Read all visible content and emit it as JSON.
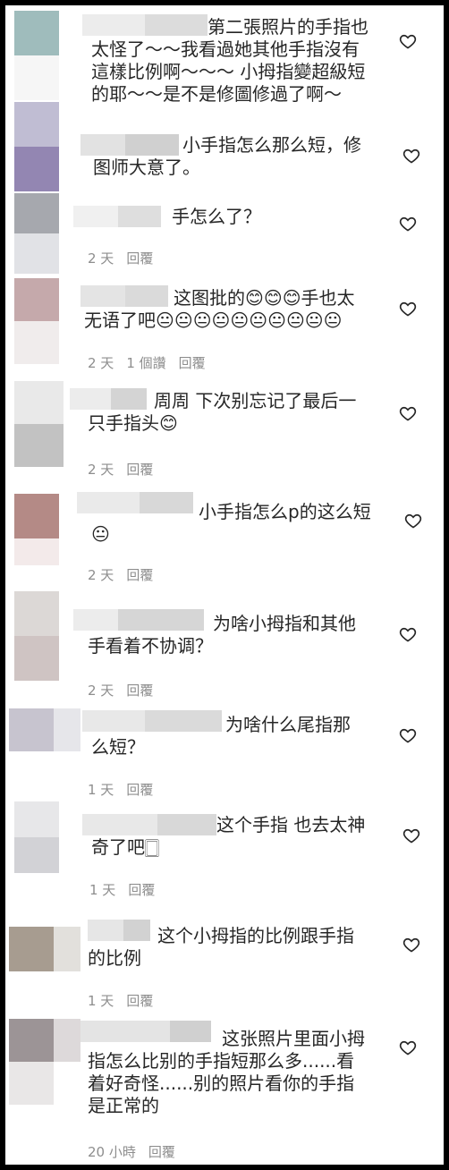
{
  "comments": [
    {
      "text": "第二張照片的手指也\n太怪了～～我看過她其他手指沒有\n這樣比例啊～～～ 小拇指變超級短\n的耶～～是不是修圖修過了啊～",
      "time": "",
      "likes": "",
      "reply": "",
      "avatar_colors": [
        "#9fbcbc",
        "#ffffff"
      ],
      "name_colors": [
        "#ececec",
        "#dcdcdc"
      ]
    },
    {
      "text": "小手指怎么那么短，修\n图师大意了。",
      "time": "",
      "likes": "",
      "reply": "",
      "avatar_colors": [
        "#c0bdd3",
        "#9386b2"
      ],
      "name_colors": [
        "#e2e2e2",
        "#d0d0d0"
      ]
    },
    {
      "text": "手怎么了？",
      "time": "2 天",
      "likes": "",
      "reply": "回覆",
      "avatar_colors": [
        "#a6a8ae",
        "#e1e2e6"
      ],
      "name_colors": [
        "#f0f0f0",
        "#dedede"
      ]
    },
    {
      "text": "这图批的😊😊😊手也太\n无语了吧😐😐😐😐😐😐😐😐😐😐",
      "time": "2 天",
      "likes": "1 個讚",
      "reply": "回覆",
      "avatar_colors": [
        "#c5a9ab",
        "#f0ecec"
      ],
      "name_colors": [
        "#e4e4e4",
        "#dadada"
      ]
    },
    {
      "text": "周周 下次别忘记了最后一\n只手指头😊",
      "time": "2 天",
      "likes": "",
      "reply": "回覆",
      "avatar_colors": [
        "#e9e9e9",
        "#c2c2c2"
      ],
      "name_colors": [
        "#ececec",
        "#d4d4d4"
      ]
    },
    {
      "text": "小手指怎么p的这么短\n😐",
      "time": "2 天",
      "likes": "",
      "reply": "回覆",
      "avatar_colors": [
        "#b48a86",
        "#f3eaea"
      ],
      "name_colors": [
        "#eaeaea",
        "#d8d8d8"
      ]
    },
    {
      "text": "为啥小拇指和其他\n手看着不协调？",
      "time": "2 天",
      "likes": "",
      "reply": "回覆",
      "avatar_colors": [
        "#dcd8d6",
        "#cfc4c3"
      ],
      "name_colors": [
        "#ececec",
        "#d6d6d6"
      ]
    },
    {
      "text": "为啥什么尾指那\n么短？",
      "time": "1 天",
      "likes": "",
      "reply": "回覆",
      "avatar_colors": [
        "#c7c4cf",
        "#e6e6ea"
      ],
      "name_colors": [
        "#e8e8e8",
        "#dadada"
      ]
    },
    {
      "text": "这个手指 也去太神\n奇了吧🀆",
      "time": "1 天",
      "likes": "",
      "reply": "回覆",
      "avatar_colors": [
        "#e7e7e9",
        "#d2d2d6"
      ],
      "name_colors": [
        "#e8e8e8",
        "#d8d8d8"
      ]
    },
    {
      "text": "这个小拇指的比例跟手指\n的比例",
      "time": "1 天",
      "likes": "",
      "reply": "回覆",
      "avatar_colors": [
        "#a79c90",
        "#e2e0dc"
      ],
      "name_colors": [
        "#e6e6e6",
        "#d2d2d2"
      ]
    },
    {
      "text": "这张照片里面小拇\n指怎么比别的手指短那么多......看\n着好奇怪......别的照片看你的手指\n是正常的",
      "time": "20 小時",
      "likes": "",
      "reply": "回覆",
      "avatar_colors": [
        "#9c9496",
        "#e9e7e7"
      ],
      "name_colors": [
        "#e4e4e4",
        "#d0d0d0"
      ]
    }
  ]
}
